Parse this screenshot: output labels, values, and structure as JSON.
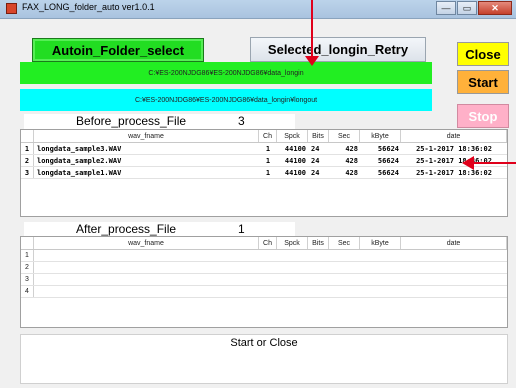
{
  "window": {
    "title": "FAX_LONG_folder_auto  ver1.0.1",
    "min": "—",
    "max": "▭",
    "close": "✕"
  },
  "buttons": {
    "auto_folder": "Autoin_Folder_select",
    "retry": "Selected_longin_Retry",
    "close": "Close",
    "start": "Start",
    "stop": "Stop"
  },
  "paths": {
    "input": "C:¥ES-200NJDG86¥ES-200NJDG86¥data_longin",
    "output": "C:¥ES-200NJDG86¥ES-200NJDG86¥data_longin¥longout"
  },
  "before": {
    "label": "Before_process_File",
    "count": "3",
    "columns": [
      "wav_fname",
      "Ch",
      "Spck",
      "Bits",
      "Sec",
      "kByte",
      "date"
    ],
    "rows": [
      {
        "idx": "1",
        "name": "longdata_sample3.WAV",
        "ch": "1",
        "spck": "44100",
        "bits": "24",
        "sec": "428",
        "kbyte": "56624",
        "date": "25-1-2017 18:36:02"
      },
      {
        "idx": "2",
        "name": "longdata_sample2.WAV",
        "ch": "1",
        "spck": "44100",
        "bits": "24",
        "sec": "428",
        "kbyte": "56624",
        "date": "25-1-2017 18:36:02"
      },
      {
        "idx": "3",
        "name": "longdata_sample1.WAV",
        "ch": "1",
        "spck": "44100",
        "bits": "24",
        "sec": "428",
        "kbyte": "56624",
        "date": "25-1-2017 18:36:02"
      }
    ]
  },
  "after": {
    "label": "After_process_File",
    "count": "1",
    "columns": [
      "wav_fname",
      "Ch",
      "Spck",
      "Bits",
      "Sec",
      "kByte",
      "date"
    ],
    "row_indices": [
      "1",
      "2",
      "3",
      "4"
    ]
  },
  "status": {
    "text": "Start or Close"
  },
  "colors": {
    "auto_button": "#22dd22",
    "path_input": "#22ee22",
    "path_output": "#00ffff",
    "close_button": "#ffff00",
    "start_button": "#ffb13a",
    "stop_button": "#ffb0c8",
    "annotation_arrow": "#e0001b"
  }
}
